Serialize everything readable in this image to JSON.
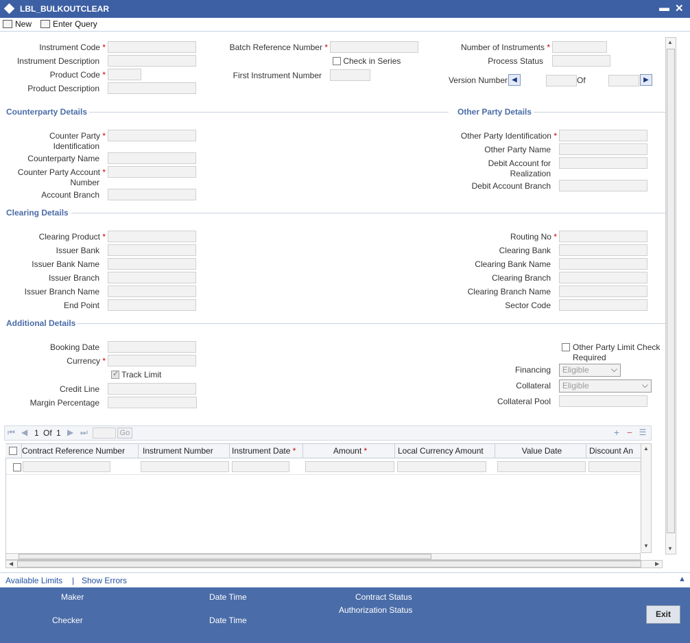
{
  "window": {
    "title": "LBL_BULKOUTCLEAR",
    "minimize": "▬",
    "close": "✕"
  },
  "toolbar": {
    "new_label": "New",
    "enter_query_label": "Enter Query"
  },
  "header": {
    "instrument_code": "Instrument Code",
    "instrument_description": "Instrument Description",
    "product_code": "Product Code",
    "product_description": "Product Description",
    "batch_reference_number": "Batch Reference Number",
    "check_in_series": "Check in Series",
    "first_instrument_number": "First Instrument Number",
    "number_of_instruments": "Number of Instruments",
    "process_status": "Process Status",
    "version_number": "Version Number",
    "of": "Of"
  },
  "counterparty": {
    "section_title": "Counterparty Details",
    "id_line1": "Counter Party",
    "id_line2": "Identification",
    "name": "Counterparty Name",
    "account_line1": "Counter Party Account",
    "account_line2": "Number",
    "account_branch": "Account Branch"
  },
  "other_party": {
    "section_title": "Other Party Details",
    "identification": "Other Party Identification",
    "name": "Other Party Name",
    "debit_line1": "Debit Account for",
    "debit_line2": "Realization",
    "debit_branch": "Debit Account Branch"
  },
  "clearing": {
    "section_title": "Clearing Details",
    "clearing_product": "Clearing Product",
    "issuer_bank": "Issuer Bank",
    "issuer_bank_name": "Issuer Bank Name",
    "issuer_branch": "Issuer Branch",
    "issuer_branch_name": "Issuer Branch Name",
    "end_point": "End Point",
    "routing_no": "Routing No",
    "clearing_bank": "Clearing Bank",
    "clearing_bank_name": "Clearing Bank Name",
    "clearing_branch": "Clearing Branch",
    "clearing_branch_name": "Clearing Branch Name",
    "sector_code": "Sector Code"
  },
  "additional": {
    "section_title": "Additional Details",
    "booking_date": "Booking Date",
    "currency": "Currency",
    "track_limit": "Track Limit",
    "credit_line": "Credit Line",
    "margin_percentage": "Margin Percentage",
    "other_party_limit_line1": "Other Party Limit Check",
    "other_party_limit_line2": "Required",
    "financing": "Financing",
    "financing_value": "Eligible",
    "collateral": "Collateral",
    "collateral_value": "Eligible",
    "collateral_pool": "Collateral Pool"
  },
  "grid": {
    "page_current": "1",
    "page_of": "Of",
    "page_total": "1",
    "go": "Go",
    "columns": [
      "Contract Reference Number",
      "Instrument Number",
      "Instrument Date",
      "Amount",
      "Local Currency Amount",
      "Value Date",
      "Discount An"
    ]
  },
  "links": {
    "available_limits": "Available Limits",
    "separator": "|",
    "show_errors": "Show Errors"
  },
  "footer": {
    "maker": "Maker",
    "date_time_1": "Date Time",
    "contract_status": "Contract Status",
    "authorization_status": "Authorization Status",
    "checker": "Checker",
    "date_time_2": "Date Time",
    "exit": "Exit"
  }
}
